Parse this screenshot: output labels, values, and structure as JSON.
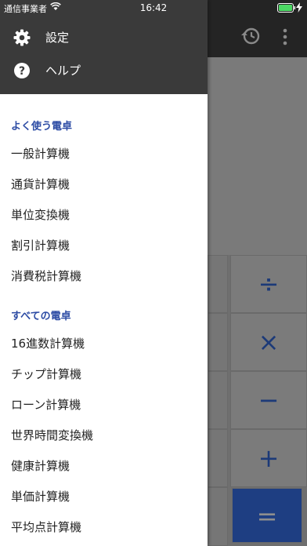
{
  "status_bar": {
    "carrier": "通信事業者",
    "time": "16:42"
  },
  "drawer": {
    "header_items": [
      {
        "label": "設定",
        "icon": "gear-icon"
      },
      {
        "label": "ヘルプ",
        "icon": "help-icon"
      }
    ],
    "favorites": {
      "title": "よく使う電卓",
      "items": [
        "一般計算機",
        "通貨計算機",
        "単位変換機",
        "割引計算機",
        "消費税計算機"
      ]
    },
    "all": {
      "title": "すべての電卓",
      "items": [
        "16進数計算機",
        "チップ計算機",
        "ローン計算機",
        "世界時間変換機",
        "健康計算機",
        "単価計算機",
        "平均点計算機"
      ]
    }
  },
  "calculator": {
    "operators": [
      "÷",
      "×",
      "−",
      "+",
      "="
    ]
  },
  "colors": {
    "accent": "#2c4ba4",
    "drawer_header": "#3a3a3a",
    "equals_key": "#1e3e82"
  }
}
